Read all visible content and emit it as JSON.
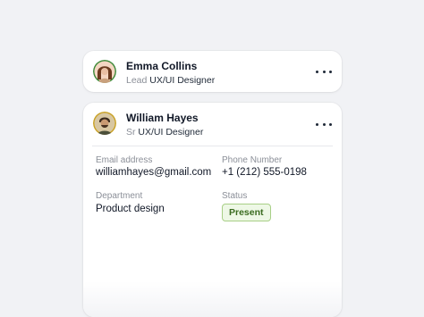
{
  "cards": [
    {
      "name": "Emma Collins",
      "level": "Lead",
      "title": "UX/UI Designer"
    },
    {
      "name": "William Hayes",
      "level": "Sr",
      "title": "UX/UI Designer",
      "details": {
        "email_label": "Email address",
        "email_value": "williamhayes@gmail.com",
        "phone_label": "Phone Number",
        "phone_value": "+1 (212) 555-0198",
        "department_label": "Department",
        "department_value": "Product design",
        "status_label": "Status",
        "status_value": "Present"
      }
    }
  ],
  "colors": {
    "status_bg": "#eef8e6",
    "status_border": "#a8cf86",
    "status_text": "#3a6b1f"
  },
  "icons": {
    "more": "more-horizontal-icon"
  }
}
